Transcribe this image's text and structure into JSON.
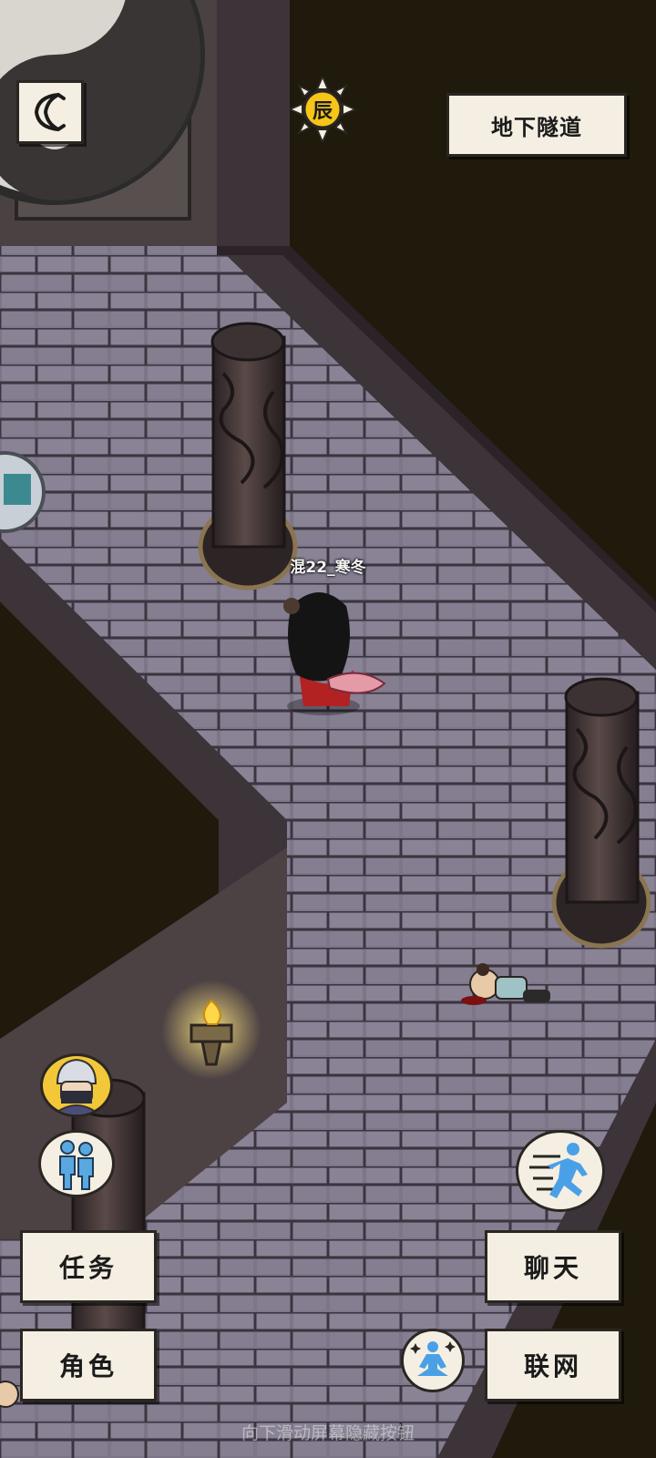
{
  "location": {
    "name": "地下隧道"
  },
  "time_badge": {
    "label": "辰"
  },
  "player": {
    "name": "混22_寒冬"
  },
  "buttons": {
    "quest": "任务",
    "character": "角色",
    "chat": "聊天",
    "network": "联网"
  },
  "hint": "向下滑动屏幕隐藏按钮",
  "colors": {
    "floor": "#7d7688",
    "mortar": "#3a3540",
    "wall": "#3d3439",
    "void": "#1f1a0c",
    "button_bg": "#f4efe2",
    "sun": "#f5c518"
  },
  "icons": {
    "back": "back-arrow-icon",
    "time": "sun-icon",
    "avatar": "masked-ninja-avatar-icon",
    "team": "team-people-icon",
    "run": "running-icon",
    "meditate": "meditation-icon",
    "torch": "torch-icon"
  }
}
